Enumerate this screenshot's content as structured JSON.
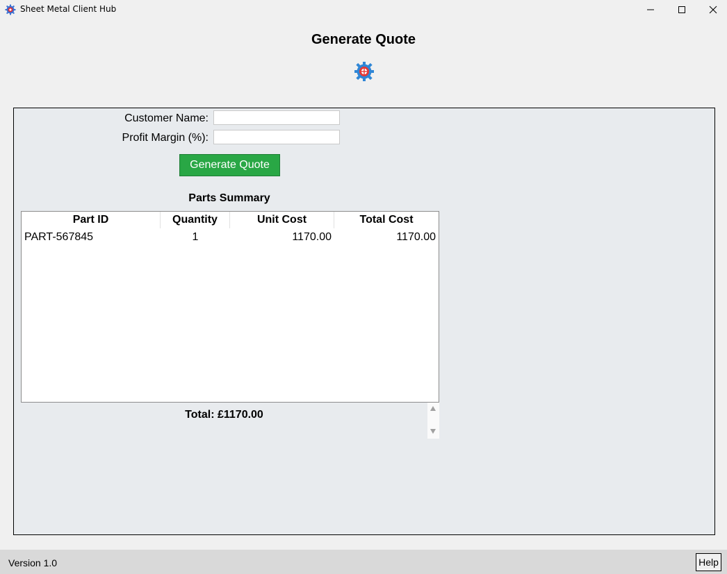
{
  "window": {
    "title": "Sheet Metal Client Hub",
    "controls": [
      "minimize-icon",
      "maximize-icon",
      "close-icon"
    ]
  },
  "page": {
    "title": "Generate Quote",
    "logo_icon": "gear-icon"
  },
  "form": {
    "customer_label": "Customer Name:",
    "customer_value": "",
    "margin_label": "Profit Margin (%):",
    "margin_value": "",
    "generate_label": "Generate Quote"
  },
  "parts": {
    "title": "Parts Summary",
    "columns": [
      "Part ID",
      "Quantity",
      "Unit Cost",
      "Total Cost"
    ],
    "rows": [
      [
        "PART-567845",
        "1",
        "1170.00",
        "1170.00"
      ]
    ],
    "total": "Total: £1170.00"
  },
  "status": {
    "version": "Version 1.0",
    "help_label": "Help"
  },
  "colors": {
    "accent": "#29a745",
    "frame_bg": "#e8ebee",
    "window_bg": "#f0f0f0",
    "status_bg": "#d9d9d9"
  }
}
